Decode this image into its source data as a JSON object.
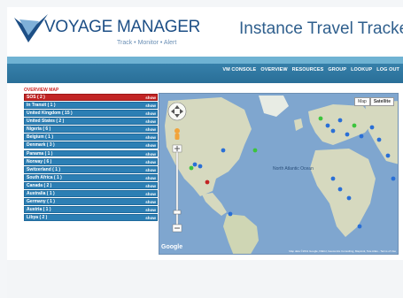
{
  "header": {
    "brand": "VOYAGE MANAGER",
    "tagline": "Track • Monitor • Alert",
    "app_title": "Instance Travel Tracker"
  },
  "nav": {
    "items": [
      "VM CONSOLE",
      "OVERVIEW",
      "RESOURCES",
      "GROUP",
      "LOOKUP",
      "LOG OUT"
    ]
  },
  "overview": {
    "label": "OVERVIEW MAP",
    "show_label": "show",
    "rows": [
      {
        "label": "SOS ( 2 )",
        "alert": true
      },
      {
        "label": "In Transit ( 1 )"
      },
      {
        "label": "United Kingdom ( 15 )"
      },
      {
        "label": "United States ( 2 )"
      },
      {
        "label": "Nigeria ( 6 )"
      },
      {
        "label": "Belgium ( 1 )"
      },
      {
        "label": "Denmark ( 3 )"
      },
      {
        "label": "Panama ( 1 )"
      },
      {
        "label": "Norway ( 6 )"
      },
      {
        "label": "Switzerland ( 1 )"
      },
      {
        "label": "South Africa ( 1 )"
      },
      {
        "label": "Canada ( 2 )"
      },
      {
        "label": "Australia ( 1 )"
      },
      {
        "label": "Germany ( 1 )"
      },
      {
        "label": "Austria ( 1 )"
      },
      {
        "label": "Libya ( 2 )"
      }
    ]
  },
  "map": {
    "type_buttons": [
      "Map",
      "Satellite"
    ],
    "google_label": "Google",
    "ocean_label": "North Atlantic Ocean",
    "copyright": "Map data ©2011 Google, INEGI, Geocentre Consulting, MapLink, Tele Atlas - Terms of Use"
  },
  "colors": {
    "nav_bar": "#2a6f98",
    "row_blue": "#2c7fb4",
    "row_sos": "#c22424",
    "ocean": "#7fa6cf",
    "land": "#d5d9c0"
  }
}
